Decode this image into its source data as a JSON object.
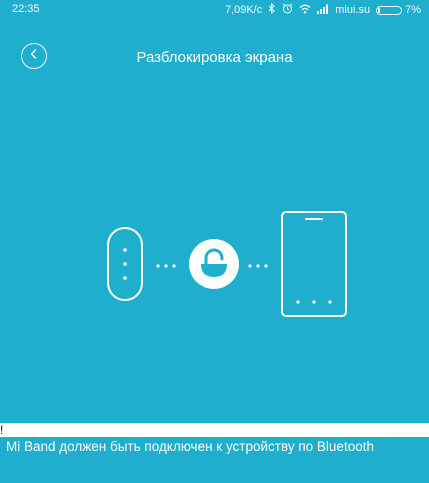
{
  "status_bar": {
    "time": "22:35",
    "speed": "7,09K/c",
    "carrier": "miui.su",
    "battery_percent": "7%",
    "battery_level": 0.07,
    "icons": [
      "bluetooth-icon",
      "alarm-icon",
      "wifi-icon",
      "signal-icon",
      "battery-icon"
    ]
  },
  "header": {
    "back_icon": "chevron-left-icon",
    "title": "Разблокировка экрана"
  },
  "illustration": {
    "left_device": "mi-band-icon",
    "center_icon": "unlock-icon",
    "right_device": "phone-icon",
    "connector": "dots"
  },
  "notice": {
    "header_text": "!",
    "message": "Mi Band должен быть подключен к устройству по Bluetooth"
  },
  "colors": {
    "background": "#20aece",
    "foreground": "#ffffff"
  }
}
